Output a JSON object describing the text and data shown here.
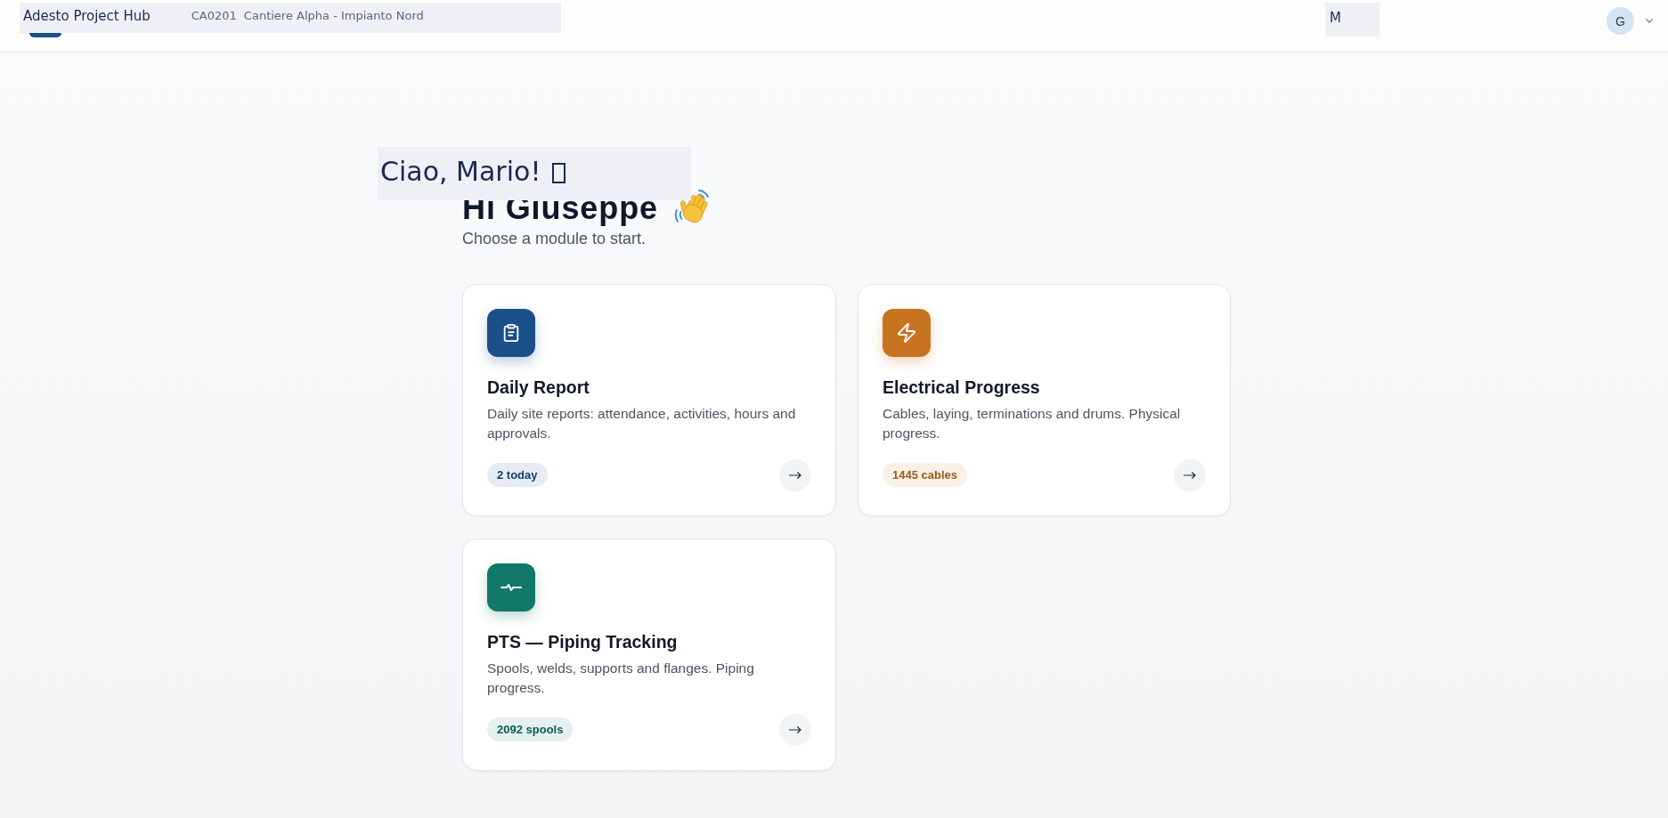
{
  "header": {
    "app_name": "Adesto Project Hub",
    "project_code": "CA0201",
    "project_name": "Cantiere Alpha - Impianto Nord",
    "initial_label": "M",
    "avatar_initial": "G"
  },
  "greeting": {
    "overlay_text": "Ciao, Mario!",
    "title": "Hi Giuseppe",
    "subtitle": "Choose a module to start."
  },
  "modules": [
    {
      "kind": "report",
      "title": "Daily Report",
      "description": "Daily site reports: attendance, activities, hours and approvals.",
      "badge": "2 today",
      "color": "#1a4f8a"
    },
    {
      "kind": "electrical",
      "title": "Electrical Progress",
      "description": "Cables, laying, terminations and drums. Physical progress.",
      "badge": "1445 cables",
      "color": "#c8731f"
    },
    {
      "kind": "piping",
      "title": "PTS — Piping Tracking",
      "description": "Spools, welds, supports and flanges. Piping progress.",
      "badge": "2092 spools",
      "color": "#11786a"
    }
  ]
}
